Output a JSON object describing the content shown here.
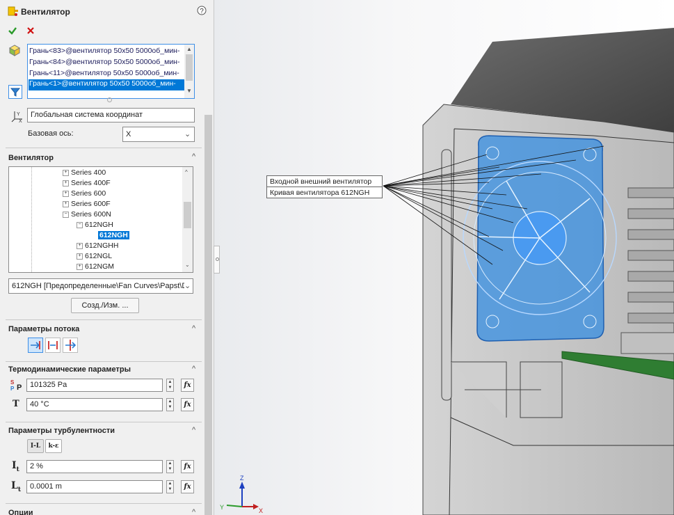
{
  "header": {
    "title": "Вентилятор"
  },
  "faces": {
    "items": [
      "Грань<83>@вентилятор 50x50 5000об_мин-",
      "Грань<84>@вентилятор 50x50 5000об_мин-",
      "Грань<11>@вентилятор 50x50 5000об_мин-",
      "Грань<1>@вентилятор 50x50 5000об_мин-"
    ]
  },
  "coords": {
    "system": "Глобальная система координат",
    "base_axis_label": "Базовая ось:",
    "base_axis_value": "X"
  },
  "fan_section": {
    "title": "Вентилятор",
    "tree": [
      {
        "label": "Series 400",
        "sign": "+"
      },
      {
        "label": "Series 400F",
        "sign": "+"
      },
      {
        "label": "Series 600",
        "sign": "+"
      },
      {
        "label": "Series 600F",
        "sign": "+"
      },
      {
        "label": "Series 600N",
        "sign": "−"
      },
      {
        "label": "612NGH",
        "sign": "−"
      },
      {
        "label": "612NGH",
        "sign": ""
      },
      {
        "label": "612NGHH",
        "sign": "+"
      },
      {
        "label": "612NGL",
        "sign": "+"
      },
      {
        "label": "612NGM",
        "sign": "+"
      }
    ],
    "selected_path": "612NGH [Предопределенные\\Fan Curves\\Papst\\D",
    "create_button": "Созд./Изм. ..."
  },
  "flow": {
    "title": "Параметры потока"
  },
  "thermo": {
    "title": "Термодинамические параметры",
    "pressure_symbol": "P",
    "pressure": "101325 Pa",
    "temp_symbol": "T",
    "temperature": "40 °C"
  },
  "turb": {
    "title": "Параметры турбулентности",
    "btn_il": "I-L",
    "btn_ke": "k-ε",
    "intensity_symbol": "I",
    "intensity_sub": "t",
    "intensity": "2 %",
    "length_symbol": "L",
    "length_sub": "t",
    "length": "0.0001 m"
  },
  "options": {
    "title": "Опции"
  },
  "callout": {
    "line1": "Входной внешний вентилятор",
    "line2": "Кривая вентилятора 612NGH"
  },
  "triad": {
    "x": "X",
    "y": "Y",
    "z": "Z"
  },
  "colors": {
    "selection": "#0078d7",
    "fan_blue": "#2b8be6",
    "accept": "#2a9a2a",
    "cancel": "#d01010"
  }
}
